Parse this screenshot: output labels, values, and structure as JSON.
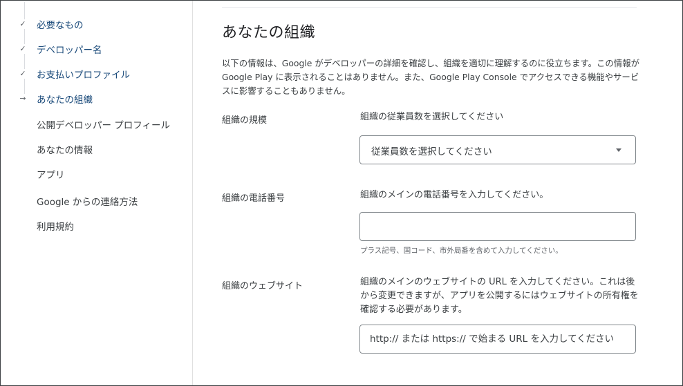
{
  "nav": {
    "items": [
      {
        "label": "必要なもの",
        "mark": "✓"
      },
      {
        "label": "デベロッパー名",
        "mark": "✓"
      },
      {
        "label": "お支払いプロファイル",
        "mark": "✓"
      },
      {
        "label": "あなたの組織",
        "mark": "→"
      },
      {
        "label": "公開デベロッパー プロフィール",
        "mark": ""
      },
      {
        "label": "あなたの情報",
        "mark": ""
      },
      {
        "label": "アプリ",
        "mark": ""
      },
      {
        "label": "Google からの連絡方法",
        "mark": ""
      },
      {
        "label": "利用規約",
        "mark": ""
      }
    ]
  },
  "main": {
    "title": "あなたの組織",
    "intro": "以下の情報は、Google がデベロッパーの詳細を確認し、組織を適切に理解するのに役立ちます。この情報が Google Play に表示されることはありません。また、Google Play Console でアクセスできる機能やサービスに影響することもありません。",
    "size": {
      "label": "組織の規模",
      "description": "組織の従業員数を選択してください",
      "selected": "従業員数を選択してください"
    },
    "phone": {
      "label": "組織の電話番号",
      "description": "組織のメインの電話番号を入力してください。",
      "value": "",
      "hint": "プラス記号、国コード、市外局番を含めて入力してください。"
    },
    "website": {
      "label": "組織のウェブサイト",
      "description": "組織のメインのウェブサイトの URL を入力してください。これは後から変更できますが、アプリを公開するにはウェブサイトの所有権を確認する必要があります。",
      "placeholder": "http:// または https:// で始まる URL を入力してください"
    }
  }
}
